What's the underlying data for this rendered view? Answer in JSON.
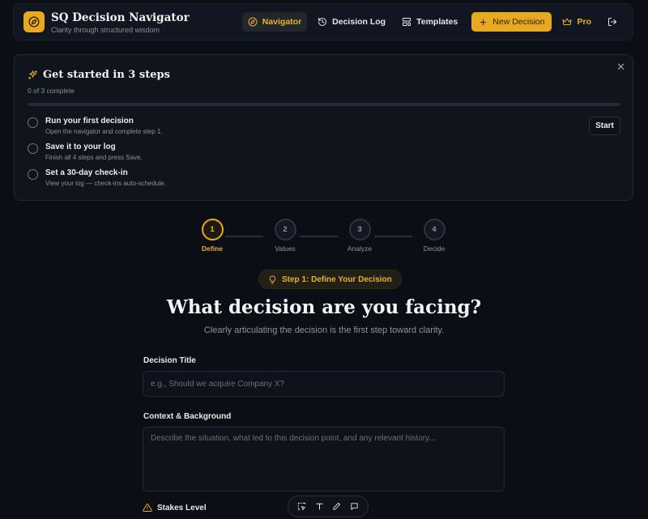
{
  "app": {
    "title": "SQ Decision Navigator",
    "subtitle": "Clarity through structured wisdom",
    "accent": "#e9a91e"
  },
  "nav": {
    "items": [
      {
        "label": "Navigator",
        "icon": "compass-icon",
        "active": true
      },
      {
        "label": "Decision Log",
        "icon": "history-icon"
      },
      {
        "label": "Templates",
        "icon": "layout-template-icon"
      }
    ],
    "new_decision": "New Decision",
    "pro": "Pro"
  },
  "onboarding": {
    "title": "Get started in 3 steps",
    "progress_text": "0 of 3 complete",
    "progress": 0,
    "start_label": "Start",
    "items": [
      {
        "title": "Run your first decision",
        "subtitle": "Open the navigator and complete step 1."
      },
      {
        "title": "Save it to your log",
        "subtitle": "Finish all 4 steps and press Save."
      },
      {
        "title": "Set a 30-day check-in",
        "subtitle": "View your log — check-ins auto-schedule."
      }
    ]
  },
  "stepper": {
    "current": 1,
    "steps": [
      {
        "number": "1",
        "label": "Define"
      },
      {
        "number": "2",
        "label": "Values"
      },
      {
        "number": "3",
        "label": "Analyze"
      },
      {
        "number": "4",
        "label": "Decide"
      }
    ]
  },
  "step_badge": "Step 1: Define Your Decision",
  "heading": {
    "title": "What decision are you facing?",
    "subtitle": "Clearly articulating the decision is the first step toward clarity."
  },
  "form": {
    "title_label": "Decision Title",
    "title_placeholder": "e.g., Should we acquire Company X?",
    "title_value": "",
    "context_label": "Context & Background",
    "context_placeholder": "Describe the situation, what led to this decision point, and any relevant history...",
    "context_value": "",
    "stakes_label": "Stakes Level"
  },
  "toolbar": {
    "tools": [
      "select-icon",
      "text-icon",
      "pen-icon",
      "comment-icon"
    ]
  }
}
